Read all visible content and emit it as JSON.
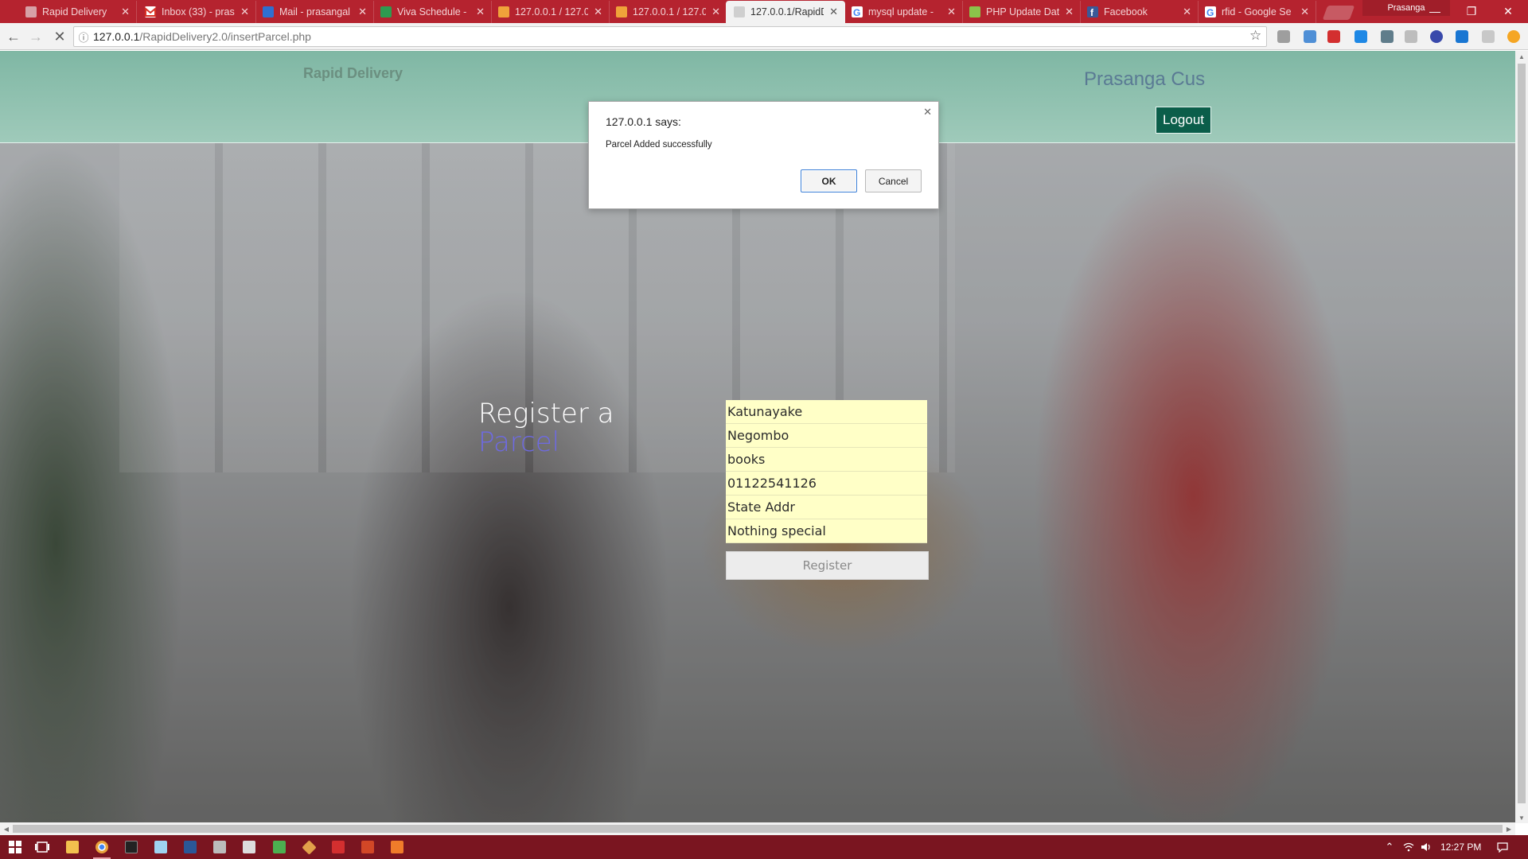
{
  "browser": {
    "tabs": [
      {
        "title": "Rapid Delivery",
        "icon": "page-icon",
        "color": "#d7a0a6",
        "active": false
      },
      {
        "title": "Inbox (33) - pras",
        "icon": "gmail-icon",
        "color": "#ffffff",
        "active": false
      },
      {
        "title": "Mail - prasangal",
        "icon": "outlook-icon",
        "color": "#2f6fd0",
        "active": false
      },
      {
        "title": "Viva Schedule -",
        "icon": "sheets-icon",
        "color": "#2e9b50",
        "active": false
      },
      {
        "title": "127.0.0.1 / 127.0",
        "icon": "phpmyadmin-icon",
        "color": "#f0a23a",
        "active": false
      },
      {
        "title": "127.0.0.1 / 127.0",
        "icon": "phpmyadmin-icon",
        "color": "#f0a23a",
        "active": false
      },
      {
        "title": "127.0.0.1/RapidD",
        "icon": "page-icon",
        "color": "#cfcfcf",
        "active": true
      },
      {
        "title": "mysql update -",
        "icon": "google-icon",
        "color": "#ffffff",
        "active": false
      },
      {
        "title": "PHP Update Dat",
        "icon": "w3schools-icon",
        "color": "#8bc34a",
        "active": false
      },
      {
        "title": "Facebook",
        "icon": "facebook-icon",
        "color": "#3b5998",
        "active": false
      },
      {
        "title": "rfid - Google Se",
        "icon": "google-icon",
        "color": "#ffffff",
        "active": false
      }
    ],
    "profile_name": "Prasanga",
    "address": {
      "host": "127.0.0.1",
      "path": "/RapidDelivery2.0/insertParcel.php"
    }
  },
  "page": {
    "brand": "Rapid Delivery",
    "username": "Prasanga  Cus",
    "logout_label": "Logout",
    "heading_line1": "Register a",
    "heading_line2": "Parcel",
    "fields": [
      {
        "name": "pickup-location-field",
        "value": "Katunayake"
      },
      {
        "name": "destination-field",
        "value": "Negombo"
      },
      {
        "name": "parcel-type-field",
        "value": "books"
      },
      {
        "name": "phone-field",
        "value": "01122541126"
      },
      {
        "name": "address-field",
        "value": "State Addr"
      },
      {
        "name": "description-field",
        "value": "Nothing special"
      }
    ],
    "register_label": "Register"
  },
  "dialog": {
    "title": "127.0.0.1 says:",
    "message": "Parcel Added successfully",
    "ok_label": "OK",
    "cancel_label": "Cancel"
  },
  "taskbar": {
    "time": "12:27 PM",
    "apps": [
      {
        "name": "file-explorer-icon",
        "color": "#f2c14e",
        "running": false
      },
      {
        "name": "chrome-icon",
        "color": "#e9a23b",
        "running": true
      },
      {
        "name": "terminal-icon",
        "color": "#222222",
        "running": false
      },
      {
        "name": "notepad-icon",
        "color": "#9fd3f0",
        "running": false
      },
      {
        "name": "word-icon",
        "color": "#2b5797",
        "running": false
      },
      {
        "name": "photos-icon",
        "color": "#bcbcbc",
        "running": false
      },
      {
        "name": "calculator-icon",
        "color": "#dddddd",
        "running": false
      },
      {
        "name": "dreamweaver-icon",
        "color": "#4caf50",
        "running": false
      },
      {
        "name": "git-icon",
        "color": "#e2a04a",
        "running": false
      },
      {
        "name": "acrobat-icon",
        "color": "#d32f2f",
        "running": false
      },
      {
        "name": "powerpoint-icon",
        "color": "#d24726",
        "running": false
      },
      {
        "name": "xampp-icon",
        "color": "#f07c2a",
        "running": false
      }
    ]
  },
  "colors": {
    "tabstrip": "#b5232f",
    "header": "#8fc1ae",
    "logout": "#0b5e4a",
    "field": "#ffffc7",
    "heading_accent": "#6e6ae3",
    "taskbar": "#7a1520"
  }
}
